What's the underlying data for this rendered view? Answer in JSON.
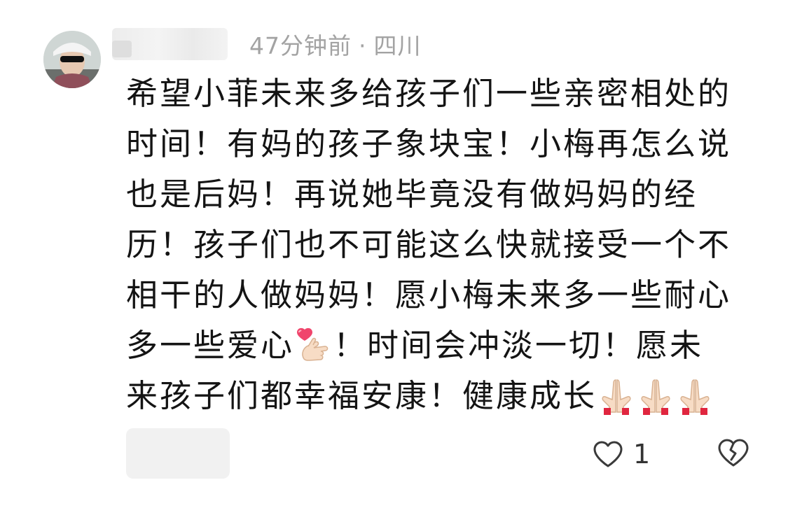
{
  "comment": {
    "time_ago": "47分钟前",
    "separator": "·",
    "location": "四川",
    "lines": [
      "希望小菲未来多给孩子们一些亲密相处的",
      "时间！有妈的孩子象块宝！小梅再怎么说",
      "也是后妈！再说她毕竟没有做妈妈的经",
      "历！孩子们也不可能这么快就接受一个不",
      "相干的人做妈妈！愿小梅未来多一些耐心",
      "多一些爱心",
      "！时间会冲淡一切！愿未",
      "来孩子们都幸福安康！健康成长"
    ],
    "emojis": {
      "heart_hand": "heart-hands-icon",
      "praying_hands": "praying-hands-icon"
    },
    "like_count": "1"
  },
  "colors": {
    "text": "#141414",
    "meta": "#a3a3a3",
    "icon": "#3a3a3a"
  }
}
